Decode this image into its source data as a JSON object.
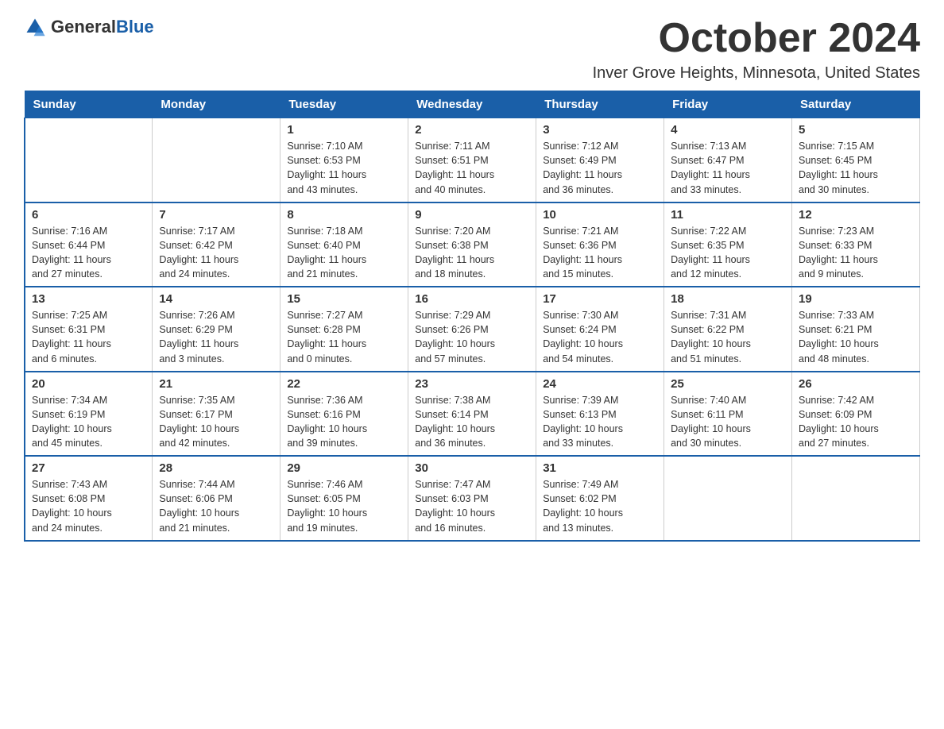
{
  "logo": {
    "general": "General",
    "blue": "Blue"
  },
  "header": {
    "month": "October 2024",
    "location": "Inver Grove Heights, Minnesota, United States"
  },
  "weekdays": [
    "Sunday",
    "Monday",
    "Tuesday",
    "Wednesday",
    "Thursday",
    "Friday",
    "Saturday"
  ],
  "weeks": [
    [
      {
        "day": "",
        "info": ""
      },
      {
        "day": "",
        "info": ""
      },
      {
        "day": "1",
        "info": "Sunrise: 7:10 AM\nSunset: 6:53 PM\nDaylight: 11 hours\nand 43 minutes."
      },
      {
        "day": "2",
        "info": "Sunrise: 7:11 AM\nSunset: 6:51 PM\nDaylight: 11 hours\nand 40 minutes."
      },
      {
        "day": "3",
        "info": "Sunrise: 7:12 AM\nSunset: 6:49 PM\nDaylight: 11 hours\nand 36 minutes."
      },
      {
        "day": "4",
        "info": "Sunrise: 7:13 AM\nSunset: 6:47 PM\nDaylight: 11 hours\nand 33 minutes."
      },
      {
        "day": "5",
        "info": "Sunrise: 7:15 AM\nSunset: 6:45 PM\nDaylight: 11 hours\nand 30 minutes."
      }
    ],
    [
      {
        "day": "6",
        "info": "Sunrise: 7:16 AM\nSunset: 6:44 PM\nDaylight: 11 hours\nand 27 minutes."
      },
      {
        "day": "7",
        "info": "Sunrise: 7:17 AM\nSunset: 6:42 PM\nDaylight: 11 hours\nand 24 minutes."
      },
      {
        "day": "8",
        "info": "Sunrise: 7:18 AM\nSunset: 6:40 PM\nDaylight: 11 hours\nand 21 minutes."
      },
      {
        "day": "9",
        "info": "Sunrise: 7:20 AM\nSunset: 6:38 PM\nDaylight: 11 hours\nand 18 minutes."
      },
      {
        "day": "10",
        "info": "Sunrise: 7:21 AM\nSunset: 6:36 PM\nDaylight: 11 hours\nand 15 minutes."
      },
      {
        "day": "11",
        "info": "Sunrise: 7:22 AM\nSunset: 6:35 PM\nDaylight: 11 hours\nand 12 minutes."
      },
      {
        "day": "12",
        "info": "Sunrise: 7:23 AM\nSunset: 6:33 PM\nDaylight: 11 hours\nand 9 minutes."
      }
    ],
    [
      {
        "day": "13",
        "info": "Sunrise: 7:25 AM\nSunset: 6:31 PM\nDaylight: 11 hours\nand 6 minutes."
      },
      {
        "day": "14",
        "info": "Sunrise: 7:26 AM\nSunset: 6:29 PM\nDaylight: 11 hours\nand 3 minutes."
      },
      {
        "day": "15",
        "info": "Sunrise: 7:27 AM\nSunset: 6:28 PM\nDaylight: 11 hours\nand 0 minutes."
      },
      {
        "day": "16",
        "info": "Sunrise: 7:29 AM\nSunset: 6:26 PM\nDaylight: 10 hours\nand 57 minutes."
      },
      {
        "day": "17",
        "info": "Sunrise: 7:30 AM\nSunset: 6:24 PM\nDaylight: 10 hours\nand 54 minutes."
      },
      {
        "day": "18",
        "info": "Sunrise: 7:31 AM\nSunset: 6:22 PM\nDaylight: 10 hours\nand 51 minutes."
      },
      {
        "day": "19",
        "info": "Sunrise: 7:33 AM\nSunset: 6:21 PM\nDaylight: 10 hours\nand 48 minutes."
      }
    ],
    [
      {
        "day": "20",
        "info": "Sunrise: 7:34 AM\nSunset: 6:19 PM\nDaylight: 10 hours\nand 45 minutes."
      },
      {
        "day": "21",
        "info": "Sunrise: 7:35 AM\nSunset: 6:17 PM\nDaylight: 10 hours\nand 42 minutes."
      },
      {
        "day": "22",
        "info": "Sunrise: 7:36 AM\nSunset: 6:16 PM\nDaylight: 10 hours\nand 39 minutes."
      },
      {
        "day": "23",
        "info": "Sunrise: 7:38 AM\nSunset: 6:14 PM\nDaylight: 10 hours\nand 36 minutes."
      },
      {
        "day": "24",
        "info": "Sunrise: 7:39 AM\nSunset: 6:13 PM\nDaylight: 10 hours\nand 33 minutes."
      },
      {
        "day": "25",
        "info": "Sunrise: 7:40 AM\nSunset: 6:11 PM\nDaylight: 10 hours\nand 30 minutes."
      },
      {
        "day": "26",
        "info": "Sunrise: 7:42 AM\nSunset: 6:09 PM\nDaylight: 10 hours\nand 27 minutes."
      }
    ],
    [
      {
        "day": "27",
        "info": "Sunrise: 7:43 AM\nSunset: 6:08 PM\nDaylight: 10 hours\nand 24 minutes."
      },
      {
        "day": "28",
        "info": "Sunrise: 7:44 AM\nSunset: 6:06 PM\nDaylight: 10 hours\nand 21 minutes."
      },
      {
        "day": "29",
        "info": "Sunrise: 7:46 AM\nSunset: 6:05 PM\nDaylight: 10 hours\nand 19 minutes."
      },
      {
        "day": "30",
        "info": "Sunrise: 7:47 AM\nSunset: 6:03 PM\nDaylight: 10 hours\nand 16 minutes."
      },
      {
        "day": "31",
        "info": "Sunrise: 7:49 AM\nSunset: 6:02 PM\nDaylight: 10 hours\nand 13 minutes."
      },
      {
        "day": "",
        "info": ""
      },
      {
        "day": "",
        "info": ""
      }
    ]
  ]
}
